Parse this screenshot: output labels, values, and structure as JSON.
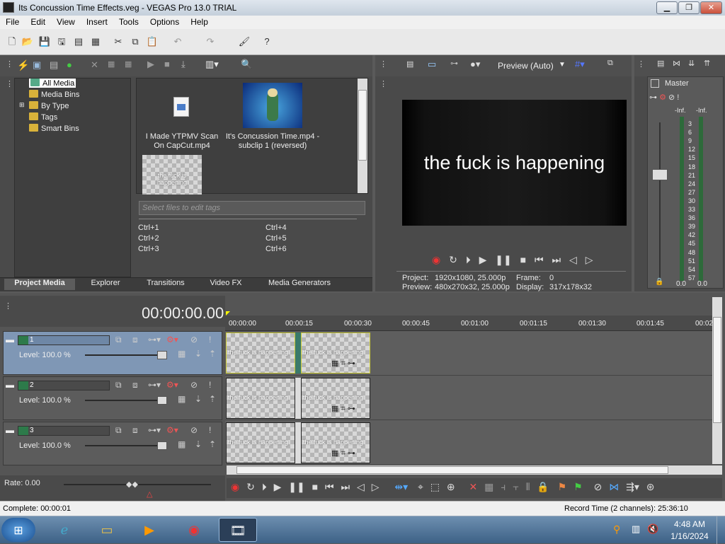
{
  "window": {
    "title": "Its Concussion Time Effects.veg - VEGAS Pro 13.0 TRIAL",
    "min": "▁",
    "max": "❐",
    "close": "✕"
  },
  "menu": [
    "File",
    "Edit",
    "View",
    "Insert",
    "Tools",
    "Options",
    "Help"
  ],
  "explorer": {
    "tree": [
      "All Media",
      "Media Bins",
      "By Type",
      "Tags",
      "Smart Bins"
    ],
    "media": [
      {
        "label": "I Made YTPMV Scan On CapCut.mp4"
      },
      {
        "label": "It's Concussion Time.mp4 - subclip 1 (reversed)"
      },
      {
        "label": "the fuck is happening"
      }
    ],
    "tags_placeholder": "Select files to edit tags",
    "shortcuts": [
      "Ctrl+1",
      "Ctrl+2",
      "Ctrl+3",
      "Ctrl+4",
      "Ctrl+5",
      "Ctrl+6"
    ],
    "tabs": [
      "Project Media",
      "Explorer",
      "Transitions",
      "Video FX",
      "Media Generators"
    ]
  },
  "preview": {
    "mode": "Preview (Auto)",
    "text": "the fuck is happening",
    "project_label": "Project:",
    "project": "1920x1080, 25.000p",
    "preview_label": "Preview:",
    "preview_res": "480x270x32, 25.000p",
    "frame_label": "Frame:",
    "frame": "0",
    "display_label": "Display:",
    "display": "317x178x32"
  },
  "master": {
    "title": "Master",
    "inf_l": "-Inf.",
    "inf_r": "-Inf.",
    "ticks": [
      "3",
      "6",
      "9",
      "12",
      "15",
      "18",
      "21",
      "24",
      "27",
      "30",
      "33",
      "36",
      "39",
      "42",
      "45",
      "48",
      "51",
      "54",
      "57"
    ],
    "val_l": "0.0",
    "val_r": "0.0"
  },
  "timeline": {
    "time": "00:00:00.00",
    "ruler": [
      "00:00:00",
      "00:00:15",
      "00:00:30",
      "00:00:45",
      "00:01:00",
      "00:01:15",
      "00:01:30",
      "00:01:45",
      "00:02"
    ],
    "tracks": [
      {
        "num": "1",
        "level": "Level: 100.0 %"
      },
      {
        "num": "2",
        "level": "Level: 100.0 %"
      },
      {
        "num": "3",
        "level": "Level: 100.0 %"
      }
    ],
    "clip_text": "the fuck is happening",
    "rate": "Rate: 0.00"
  },
  "status": {
    "left": "Complete: 00:00:01",
    "right": "Record Time (2 channels): 25:36:10"
  },
  "taskbar": {
    "time": "4:48 AM",
    "date": "1/16/2024"
  }
}
